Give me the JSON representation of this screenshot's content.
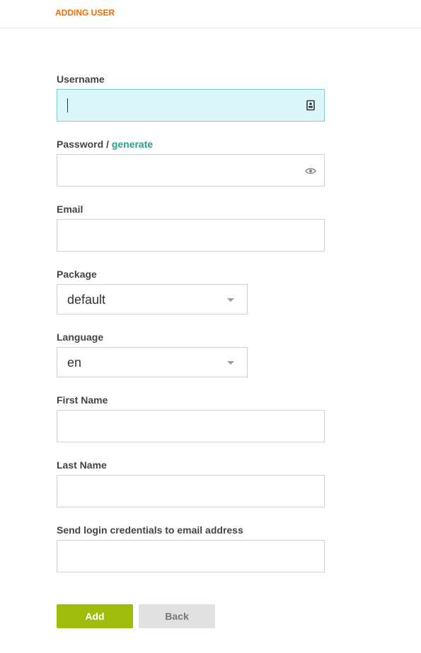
{
  "header": {
    "title": "ADDING USER"
  },
  "form": {
    "username": {
      "label": "Username",
      "value": "",
      "icon": "contact-card-icon"
    },
    "password": {
      "label": "Password",
      "separator": " / ",
      "generate_link": "generate",
      "value": "",
      "icon": "eye-icon"
    },
    "email": {
      "label": "Email",
      "value": ""
    },
    "package": {
      "label": "Package",
      "selected": "default"
    },
    "language": {
      "label": "Language",
      "selected": "en"
    },
    "first_name": {
      "label": "First Name",
      "value": ""
    },
    "last_name": {
      "label": "Last Name",
      "value": ""
    },
    "send_credentials": {
      "label": "Send login credentials to email address",
      "value": ""
    }
  },
  "actions": {
    "add_label": "Add",
    "back_label": "Back"
  },
  "colors": {
    "title": "#ef6c00",
    "link": "#2a9d8f",
    "add_button": "#a0bd0c",
    "back_button": "#e0e0e0",
    "focused_field": "#dcf7fb"
  }
}
